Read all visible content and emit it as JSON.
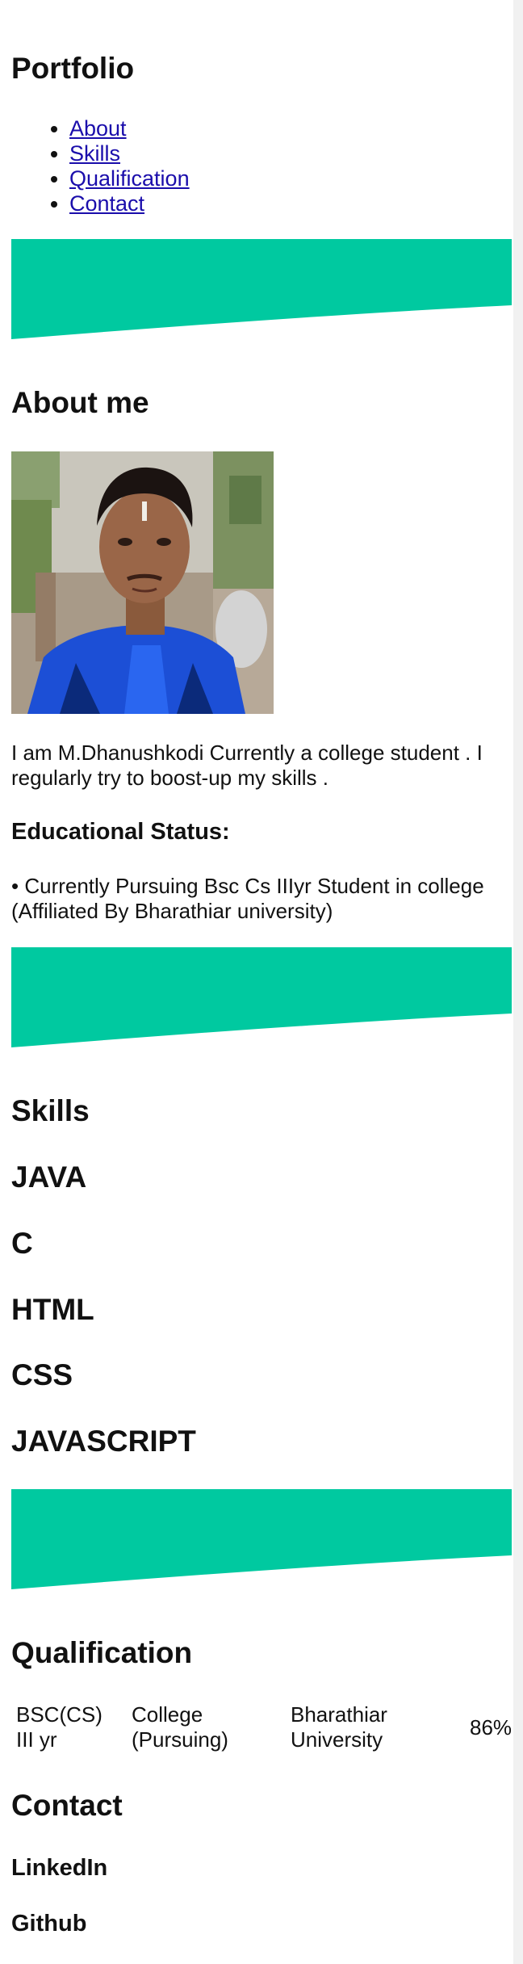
{
  "site": {
    "title": "Portfolio"
  },
  "nav": {
    "items": [
      "About",
      "Skills",
      "Qualification",
      "Contact"
    ]
  },
  "about": {
    "heading": "About me",
    "intro": "I am M.Dhanushkodi Currently a college student . I regularly try to boost-up my skills .",
    "education_heading": "Educational Status:",
    "education_text": "• Currently Pursuing Bsc Cs IIIyr Student in college (Affiliated By Bharathiar university)"
  },
  "skills": {
    "heading": "Skills",
    "items": [
      "JAVA",
      "C",
      "HTML",
      "CSS",
      "JAVASCRIPT"
    ]
  },
  "qualification": {
    "heading": "Qualification",
    "row": [
      "BSC(CS) III yr",
      "College (Pursuing)",
      "Bharathiar University",
      "86%"
    ]
  },
  "contact": {
    "heading": "Contact",
    "links": [
      "LinkedIn",
      "Github"
    ]
  },
  "colors": {
    "accent": "#00c9a0",
    "link": "#1a0dab"
  }
}
